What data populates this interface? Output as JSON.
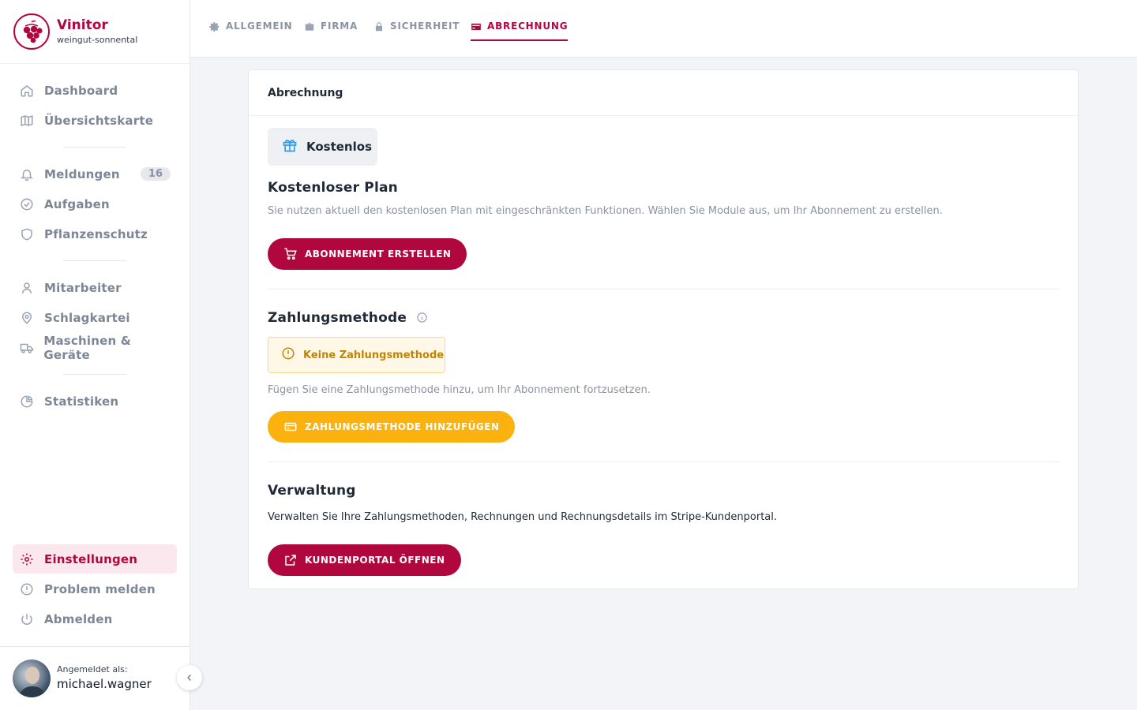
{
  "brand": {
    "name": "Vinitor",
    "subtitle": "weingut-sonnental"
  },
  "sidebar": {
    "groups": [
      [
        {
          "label": "Dashboard",
          "icon": "home-icon"
        },
        {
          "label": "Übersichtskarte",
          "icon": "map-icon"
        }
      ],
      [
        {
          "label": "Meldungen",
          "icon": "bell-icon",
          "badge": "16"
        },
        {
          "label": "Aufgaben",
          "icon": "check-circle-icon"
        },
        {
          "label": "Pflanzenschutz",
          "icon": "shield-icon"
        }
      ],
      [
        {
          "label": "Mitarbeiter",
          "icon": "user-icon"
        },
        {
          "label": "Schlagkartei",
          "icon": "map-pin-icon"
        },
        {
          "label": "Maschinen & Geräte",
          "icon": "truck-icon"
        }
      ],
      [
        {
          "label": "Statistiken",
          "icon": "pie-chart-icon"
        }
      ]
    ],
    "bottom": [
      {
        "label": "Einstellungen",
        "icon": "gear-icon",
        "active": true
      },
      {
        "label": "Problem melden",
        "icon": "alert-circle-icon"
      },
      {
        "label": "Abmelden",
        "icon": "power-icon"
      }
    ]
  },
  "user": {
    "label": "Angemeldet als:",
    "name": "michael.wagner"
  },
  "tabs": [
    {
      "label": "ALLGEMEIN",
      "icon": "gear-icon"
    },
    {
      "label": "FIRMA",
      "icon": "briefcase-icon"
    },
    {
      "label": "SICHERHEIT",
      "icon": "lock-icon"
    },
    {
      "label": "ABRECHNUNG",
      "icon": "credit-card-icon",
      "active": true
    }
  ],
  "billing": {
    "header": "Abrechnung",
    "plan_chip": "Kostenlos",
    "plan_title": "Kostenloser Plan",
    "plan_desc": "Sie nutzen aktuell den kostenlosen Plan mit eingeschränkten Funktionen. Wählen Sie Module aus, um Ihr Abonnement zu erstellen.",
    "subscribe_button": "ABONNEMENT ERSTELLEN",
    "payment_title": "Zahlungsmethode",
    "payment_warning": "Keine Zahlungsmethode",
    "payment_desc": "Fügen Sie eine Zahlungsmethode hinzu, um Ihr Abonnement fortzusetzen.",
    "payment_button": "ZAHLUNGSMETHODE HINZUFÜGEN",
    "manage_title": "Verwaltung",
    "manage_desc": "Verwalten Sie Ihre Zahlungsmethoden, Rechnungen und Rechnungsdetails im Stripe-Kundenportal.",
    "portal_button": "KUNDENPORTAL ÖFFNEN"
  },
  "colors": {
    "brand": "#b0083e",
    "warning": "#fbb10e",
    "info": "#2f9be8"
  }
}
